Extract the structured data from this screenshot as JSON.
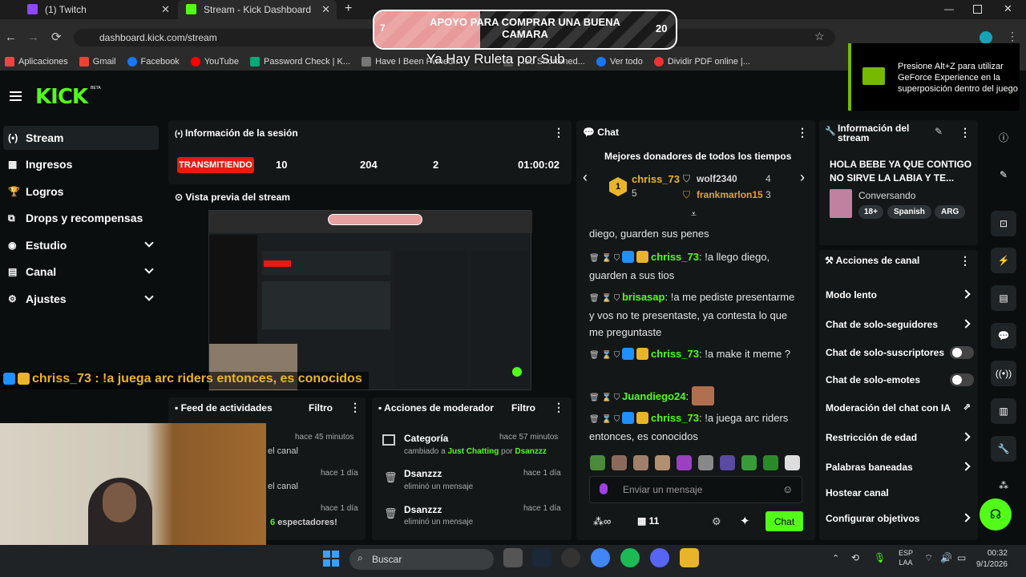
{
  "browser": {
    "tabs": [
      {
        "label": "(1) Twitch",
        "color": "#9146ff"
      },
      {
        "label": "Stream - Kick Dashboard",
        "color": "#53fc18"
      }
    ],
    "new_tab": "+",
    "url": "dashboard.kick.com/stream",
    "bookmarks": [
      "Aplicaciones",
      "Gmail",
      "Facebook",
      "YouTube",
      "Password Check | K...",
      "Have I Been Pwned...",
      "...ed Shortened...",
      "Ver todo",
      "Dividir PDF online |..."
    ]
  },
  "overlay": {
    "goal_left": "7",
    "goal_title": "APOYO PARA COMPRAR UNA BUENA CAMARA",
    "goal_right": "20",
    "goal_progress": 0.35,
    "roulette": "Ya Hay Ruleta por Sub",
    "ticker": "chriss_73 : !a juega arc riders entonces, es conocidos",
    "geforce": "Presione Alt+Z para utilizar GeForce Experience en la superposición dentro del juego"
  },
  "kick": {
    "logo": "KICK",
    "beta": "BETA",
    "nav": [
      {
        "label": "Stream",
        "icon": "stream-icon",
        "active": true,
        "chevron": false
      },
      {
        "label": "Ingresos",
        "icon": "revenue-icon",
        "chevron": false
      },
      {
        "label": "Logros",
        "icon": "trophy-icon",
        "chevron": false
      },
      {
        "label": "Drops y recompensas",
        "icon": "drops-icon",
        "chevron": false
      },
      {
        "label": "Estudio",
        "icon": "studio-icon",
        "chevron": true
      },
      {
        "label": "Canal",
        "icon": "channel-icon",
        "chevron": true
      },
      {
        "label": "Ajustes",
        "icon": "settings-icon",
        "chevron": true
      }
    ]
  },
  "session": {
    "title": "Información de la sesión",
    "status": "TRANSMITIENDO",
    "stats": [
      "10",
      "204",
      "2",
      "01:00:02"
    ],
    "preview_title": "Vista previa del stream"
  },
  "feed": {
    "title": "Feed de actividades",
    "filter": "Filtro",
    "rows": [
      {
        "time": "hace 45 minutos",
        "text": "el canal"
      },
      {
        "time": "hace 1 día",
        "text": "el canal"
      },
      {
        "time": "hace 1 día",
        "text_num": "6",
        "text": "espectadores!"
      }
    ]
  },
  "mod": {
    "title": "Acciones de moderador",
    "filter": "Filtro",
    "rows": [
      {
        "name": "Categoría",
        "time": "hace 57 minutos",
        "pre": "cambiado a",
        "cat": "Just Chatting",
        "por": "por",
        "who": "Dsanzzz"
      },
      {
        "name": "Dsanzzz",
        "time": "hace 1 día",
        "desc": "eliminó un mensaje"
      },
      {
        "name": "Dsanzzz",
        "time": "hace 1 día",
        "desc": "eliminó un mensaje"
      }
    ]
  },
  "chat": {
    "title": "Chat",
    "top_title": "Mejores donadores de todos los tiempos",
    "donors": [
      {
        "name": "chriss_73",
        "count": "5",
        "rank": "1"
      },
      {
        "name": "wolf2340",
        "count": "4"
      },
      {
        "name": "frankmarlon15",
        "count": "3"
      }
    ],
    "messages": [
      {
        "user": "",
        "text": "diego, guarden sus penes"
      },
      {
        "user": "chriss_73",
        "text": "!a llego diego, guarden a sus tios"
      },
      {
        "user": "brisasap",
        "text": "!a me pediste presentarme y vos no te presentaste, ya contesta lo que me preguntaste"
      },
      {
        "user": "chriss_73",
        "text": "!a make it meme ?"
      },
      {
        "user": "Juandiego24",
        "text": ""
      },
      {
        "user": "chriss_73",
        "text": "!a juega arc riders entonces, es conocidos"
      }
    ],
    "placeholder": "Enviar un mensaje",
    "count": "11",
    "send": "Chat"
  },
  "stream_info": {
    "title": "Información del stream",
    "stream_title": "HOLA BEBE YA QUE CONTIGO NO SIRVE LA LABIA Y TE...",
    "category": "Conversando",
    "tags": [
      "18+",
      "Spanish",
      "ARG"
    ]
  },
  "channel_actions": {
    "title": "Acciones de canal",
    "items": [
      {
        "label": "Modo lento",
        "kind": "arrow"
      },
      {
        "label": "Chat de solo-seguidores",
        "kind": "arrow"
      },
      {
        "label": "Chat de solo-suscriptores",
        "kind": "toggle"
      },
      {
        "label": "Chat de solo-emotes",
        "kind": "toggle"
      },
      {
        "label": "Moderación del chat con IA",
        "kind": "external"
      },
      {
        "label": "Restricción de edad",
        "kind": "arrow"
      },
      {
        "label": "Palabras baneadas",
        "kind": "arrow"
      },
      {
        "label": "Hostear canal",
        "kind": "none"
      },
      {
        "label": "Configurar objetivos",
        "kind": "arrow"
      }
    ]
  },
  "taskbar": {
    "search": "Buscar",
    "lang1": "ESP",
    "lang2": "LAA",
    "time": "00:32",
    "date": "9/1/2026"
  }
}
